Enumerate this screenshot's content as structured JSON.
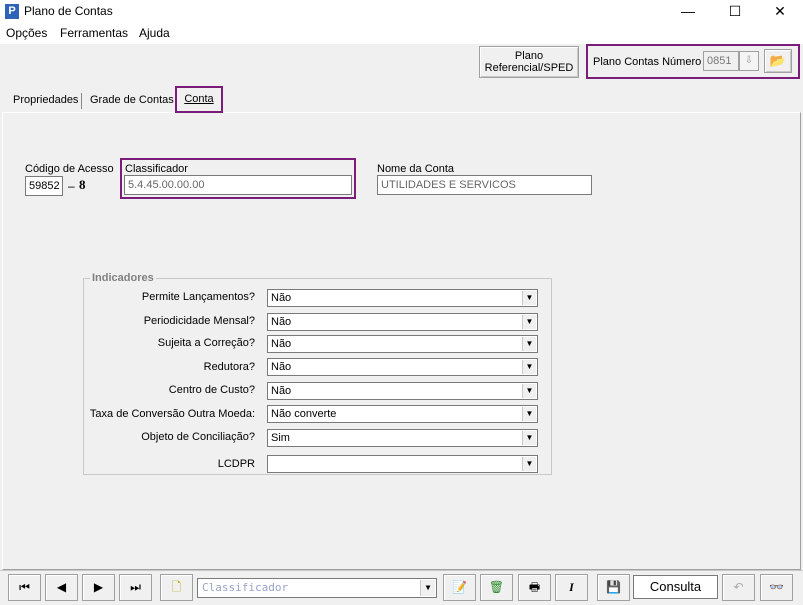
{
  "window": {
    "title": "Plano de Contas",
    "minimize": "—",
    "maximize": "☐",
    "close": "✕",
    "icon_letter": "P"
  },
  "menu": {
    "items": [
      "Opções",
      "Ferramentas",
      "Ajuda"
    ]
  },
  "header": {
    "ref_button_line1": "Plano",
    "ref_button_line2": "Referencial/SPED",
    "plano_label": "Plano Contas Número",
    "plano_value": "0851"
  },
  "tabs": [
    {
      "label": "Propriedades"
    },
    {
      "label": "Grade de Contas"
    },
    {
      "label": "Conta"
    }
  ],
  "form": {
    "codigo_label": "Código de Acesso",
    "codigo_value": "59852",
    "codigo_dash": "–",
    "codigo_digit": "8",
    "classificador_label": "Classificador",
    "classificador_value": "5.4.45.00.00.00",
    "nome_label": "Nome da Conta",
    "nome_value": "UTILIDADES E SERVICOS"
  },
  "indicadores": {
    "title": "Indicadores",
    "rows": [
      {
        "label": "Permite Lançamentos?",
        "value": "Não"
      },
      {
        "label": "Periodicidade Mensal?",
        "value": "Não"
      },
      {
        "label": "Sujeita a Correção?",
        "value": "Não"
      },
      {
        "label": "Redutora?",
        "value": "Não"
      },
      {
        "label": "Centro de Custo?",
        "value": "Não"
      },
      {
        "label": "Taxa de Conversão Outra Moeda:",
        "value": "Não converte"
      },
      {
        "label": "Objeto de Conciliação?",
        "value": "Sim"
      },
      {
        "label": "LCDPR",
        "value": ""
      }
    ]
  },
  "toolbar": {
    "search_placeholder": "Classificador",
    "status": "Consulta"
  },
  "colors": {
    "highlight": "#7a1c7a",
    "app_icon": "#2e63b8"
  }
}
